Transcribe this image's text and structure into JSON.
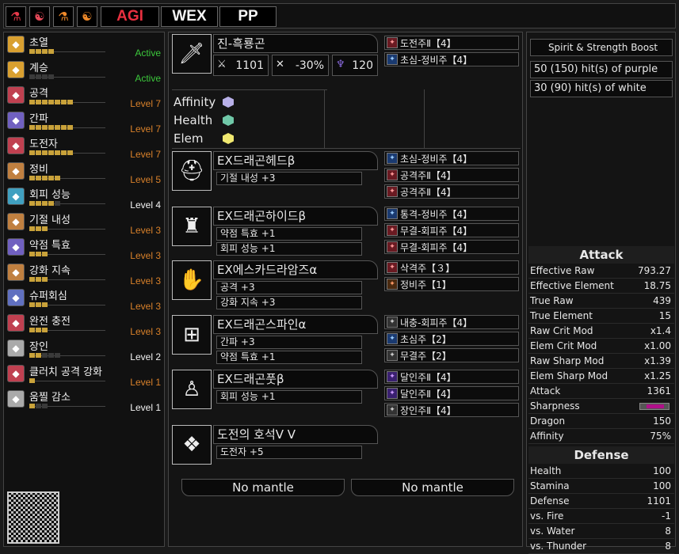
{
  "topbar": {
    "icons": [
      "flask-icon",
      "beast-icon",
      "flask-orange-icon",
      "beast-orange-icon"
    ],
    "tags": [
      "AGI",
      "WEX",
      "PP"
    ]
  },
  "skills": [
    {
      "name": "초열",
      "level": "Active",
      "pips": 4,
      "max": 4,
      "color": "#d9a030",
      "style": "active"
    },
    {
      "name": "계승",
      "level": "Active",
      "pips": 0,
      "max": 4,
      "color": "#d9a030",
      "style": "active"
    },
    {
      "name": "공격",
      "level": "Level 7",
      "pips": 7,
      "max": 7,
      "color": "#c04050",
      "style": "orange"
    },
    {
      "name": "간파",
      "level": "Level 7",
      "pips": 7,
      "max": 7,
      "color": "#7060c0",
      "style": "orange"
    },
    {
      "name": "도전자",
      "level": "Level 7",
      "pips": 7,
      "max": 7,
      "color": "#c04050",
      "style": "orange"
    },
    {
      "name": "정비",
      "level": "Level 5",
      "pips": 5,
      "max": 5,
      "color": "#c08040",
      "style": "orange"
    },
    {
      "name": "회피 성능",
      "level": "Level 4",
      "pips": 4,
      "max": 5,
      "color": "#40a0c0",
      "style": "white"
    },
    {
      "name": "기절 내성",
      "level": "Level 3",
      "pips": 3,
      "max": 3,
      "color": "#c08040",
      "style": "orange"
    },
    {
      "name": "약점 특효",
      "level": "Level 3",
      "pips": 3,
      "max": 3,
      "color": "#7060c0",
      "style": "orange"
    },
    {
      "name": "강화 지속",
      "level": "Level 3",
      "pips": 3,
      "max": 3,
      "color": "#c08040",
      "style": "orange"
    },
    {
      "name": "슈퍼회심",
      "level": "Level 3",
      "pips": 3,
      "max": 3,
      "color": "#6070c0",
      "style": "orange"
    },
    {
      "name": "완전 충전",
      "level": "Level 3",
      "pips": 3,
      "max": 3,
      "color": "#c04050",
      "style": "orange"
    },
    {
      "name": "장인",
      "level": "Level 2",
      "pips": 2,
      "max": 5,
      "color": "#aaaaaa",
      "style": "white"
    },
    {
      "name": "클러치 공격 강화",
      "level": "Level 1",
      "pips": 1,
      "max": 1,
      "color": "#c04050",
      "style": "orange"
    },
    {
      "name": "움찔 감소",
      "level": "Level 1",
      "pips": 1,
      "max": 3,
      "color": "#aaaaaa",
      "style": "white"
    }
  ],
  "weapon": {
    "name": "진-흑룡곤",
    "attack": "1101",
    "affinity": "-30%",
    "element": "120",
    "decos": [
      {
        "label": "도전주Ⅱ【4】",
        "color": "red"
      },
      {
        "label": "초심-정비주【4】",
        "color": "blue"
      }
    ],
    "stats_labels": [
      "Affinity",
      "Health",
      "Elem"
    ],
    "gem_colors": [
      "#b8b0e8",
      "#70c8a8",
      "#f0e870"
    ]
  },
  "armor": [
    {
      "name": "EX드래곤헤드β",
      "skills": [
        "기절 내성 +3"
      ],
      "icon": "helm-icon",
      "decos": [
        {
          "label": "초심-정비주【4】",
          "color": "blue"
        },
        {
          "label": "공격주Ⅱ【4】",
          "color": "red"
        },
        {
          "label": "공격주Ⅱ【4】",
          "color": "red"
        }
      ]
    },
    {
      "name": "EX드래곤하이드β",
      "skills": [
        "약점 특효 +1",
        "회피 성능 +1"
      ],
      "icon": "chest-icon",
      "decos": [
        {
          "label": "통격-정비주【4】",
          "color": "blue"
        },
        {
          "label": "무결-회피주【4】",
          "color": "red"
        },
        {
          "label": "무결-회피주【4】",
          "color": "red"
        }
      ]
    },
    {
      "name": "EX에스카드라암즈α",
      "skills": [
        "공격 +3",
        "강화 지속 +3"
      ],
      "icon": "arm-icon",
      "decos": [
        {
          "label": "삭격주【３】",
          "color": "red"
        },
        {
          "label": "정비주【1】",
          "color": "brown"
        }
      ]
    },
    {
      "name": "EX드래곤스파인α",
      "skills": [
        "간파 +3",
        "약점 특효 +1"
      ],
      "icon": "waist-icon",
      "decos": [
        {
          "label": "내충-회피주【4】",
          "color": "grey"
        },
        {
          "label": "초심주【2】",
          "color": "blue"
        },
        {
          "label": "무결주【2】",
          "color": "grey"
        }
      ]
    },
    {
      "name": "EX드래곤풋β",
      "skills": [
        "회피 성능 +1"
      ],
      "icon": "leg-icon",
      "decos": [
        {
          "label": "달인주Ⅱ【4】",
          "color": "purple"
        },
        {
          "label": "달인주Ⅱ【4】",
          "color": "purple"
        },
        {
          "label": "장인주Ⅱ【4】",
          "color": "grey"
        }
      ]
    },
    {
      "name": "도전의 호석Ⅴ Ⅴ",
      "skills": [
        "도전자 +5"
      ],
      "icon": "charm-icon",
      "decos": []
    }
  ],
  "mantles": [
    "No mantle",
    "No mantle"
  ],
  "right": {
    "boosts": [
      "Spirit & Strength Boost",
      "50 (150) hit(s) of purple",
      "30 (90) hit(s) of white"
    ],
    "attack_title": "Attack",
    "attack": [
      [
        "Effective Raw",
        "793.27"
      ],
      [
        "Effective Element",
        "18.75"
      ],
      [
        "True Raw",
        "439"
      ],
      [
        "True Element",
        "15"
      ],
      [
        "Raw Crit Mod",
        "x1.4"
      ],
      [
        "Elem Crit Mod",
        "x1.00"
      ],
      [
        "Raw Sharp Mod",
        "x1.39"
      ],
      [
        "Elem Sharp Mod",
        "x1.25"
      ],
      [
        "Attack",
        "1361"
      ],
      [
        "Sharpness",
        ""
      ],
      [
        "Dragon",
        "150"
      ],
      [
        "Affinity",
        "75%"
      ]
    ],
    "defense_title": "Defense",
    "defense": [
      [
        "Health",
        "100"
      ],
      [
        "Stamina",
        "100"
      ],
      [
        "Defense",
        "1101"
      ],
      [
        "vs. Fire",
        "-1"
      ],
      [
        "vs. Water",
        "8"
      ],
      [
        "vs. Thunder",
        "8"
      ]
    ]
  }
}
